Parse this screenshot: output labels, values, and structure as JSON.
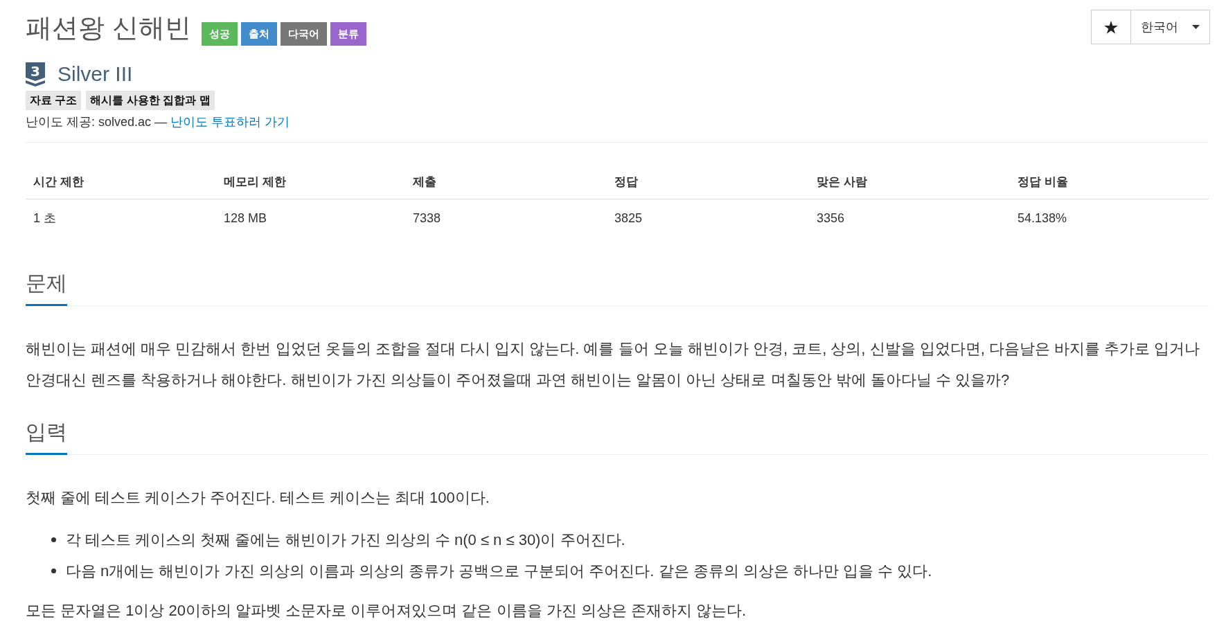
{
  "header": {
    "title": "패션왕 신해빈",
    "labels": [
      {
        "text": "성공",
        "color": "#5cb85c"
      },
      {
        "text": "출처",
        "color": "#428bca"
      },
      {
        "text": "다국어",
        "color": "#777777"
      },
      {
        "text": "분류",
        "color": "#9966cc"
      }
    ]
  },
  "toolbar": {
    "language": "한국어"
  },
  "tier": {
    "numeral": "3",
    "name": "Silver III"
  },
  "tags": [
    "자료 구조",
    "해시를 사용한 집합과 맵"
  ],
  "difficulty_credit": {
    "text": "난이도 제공: solved.ac —",
    "link": "난이도 투표하러 가기"
  },
  "table": {
    "columns": [
      "시간 제한",
      "메모리 제한",
      "제출",
      "정답",
      "맞은 사람",
      "정답 비율"
    ],
    "rows": [
      [
        "1 초",
        "128 MB",
        "7338",
        "3825",
        "3356",
        "54.138%"
      ]
    ]
  },
  "sections": [
    {
      "heading": "문제",
      "blocks": [
        {
          "kind": "paragraph",
          "text": "해빈이는 패션에 매우 민감해서 한번 입었던 옷들의 조합을 절대 다시 입지 않는다. 예를 들어 오늘 해빈이가 안경, 코트, 상의, 신발을 입었다면, 다음날은 바지를 추가로 입거나 안경대신 렌즈를 착용하거나 해야한다. 해빈이가 가진 의상들이 주어졌을때 과연 해빈이는 알몸이 아닌 상태로 며칠동안 밖에 돌아다닐 수 있을까?"
        }
      ]
    },
    {
      "heading": "입력",
      "blocks": [
        {
          "kind": "paragraph",
          "text": "첫째 줄에 테스트 케이스가 주어진다. 테스트 케이스는 최대 100이다."
        },
        {
          "kind": "list",
          "items": [
            "각 테스트 케이스의 첫째 줄에는 해빈이가 가진 의상의 수 n(0 ≤ n ≤ 30)이 주어진다.",
            "다음 n개에는 해빈이가 가진 의상의 이름과 의상의 종류가 공백으로 구분되어 주어진다. 같은 종류의 의상은 하나만 입을 수 있다."
          ]
        },
        {
          "kind": "paragraph",
          "text": "모든 문자열은 1이상 20이하의 알파벳 소문자로 이루어져있으며 같은 이름을 가진 의상은 존재하지 않는다."
        }
      ]
    }
  ]
}
